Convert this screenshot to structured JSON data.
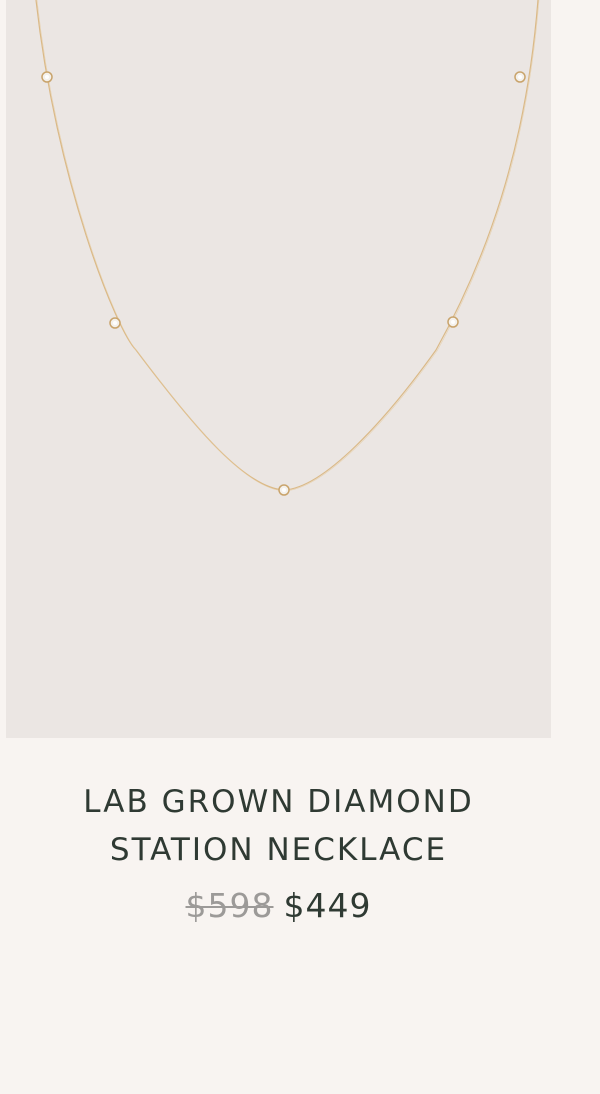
{
  "product": {
    "title_line1": "LAB GROWN DIAMOND",
    "title_line2": "STATION NECKLACE",
    "price_original": "$598",
    "price_sale": "$449",
    "image": {
      "depicts": "necklace-icon",
      "background_color": "#ebe6e3",
      "chain_color": "#d8b47c",
      "stone_color": "#f4f1ec"
    }
  },
  "colors": {
    "page_background": "#f8f4f1",
    "text_primary": "#2f3a33",
    "text_strikethrough": "#9c9a98"
  }
}
